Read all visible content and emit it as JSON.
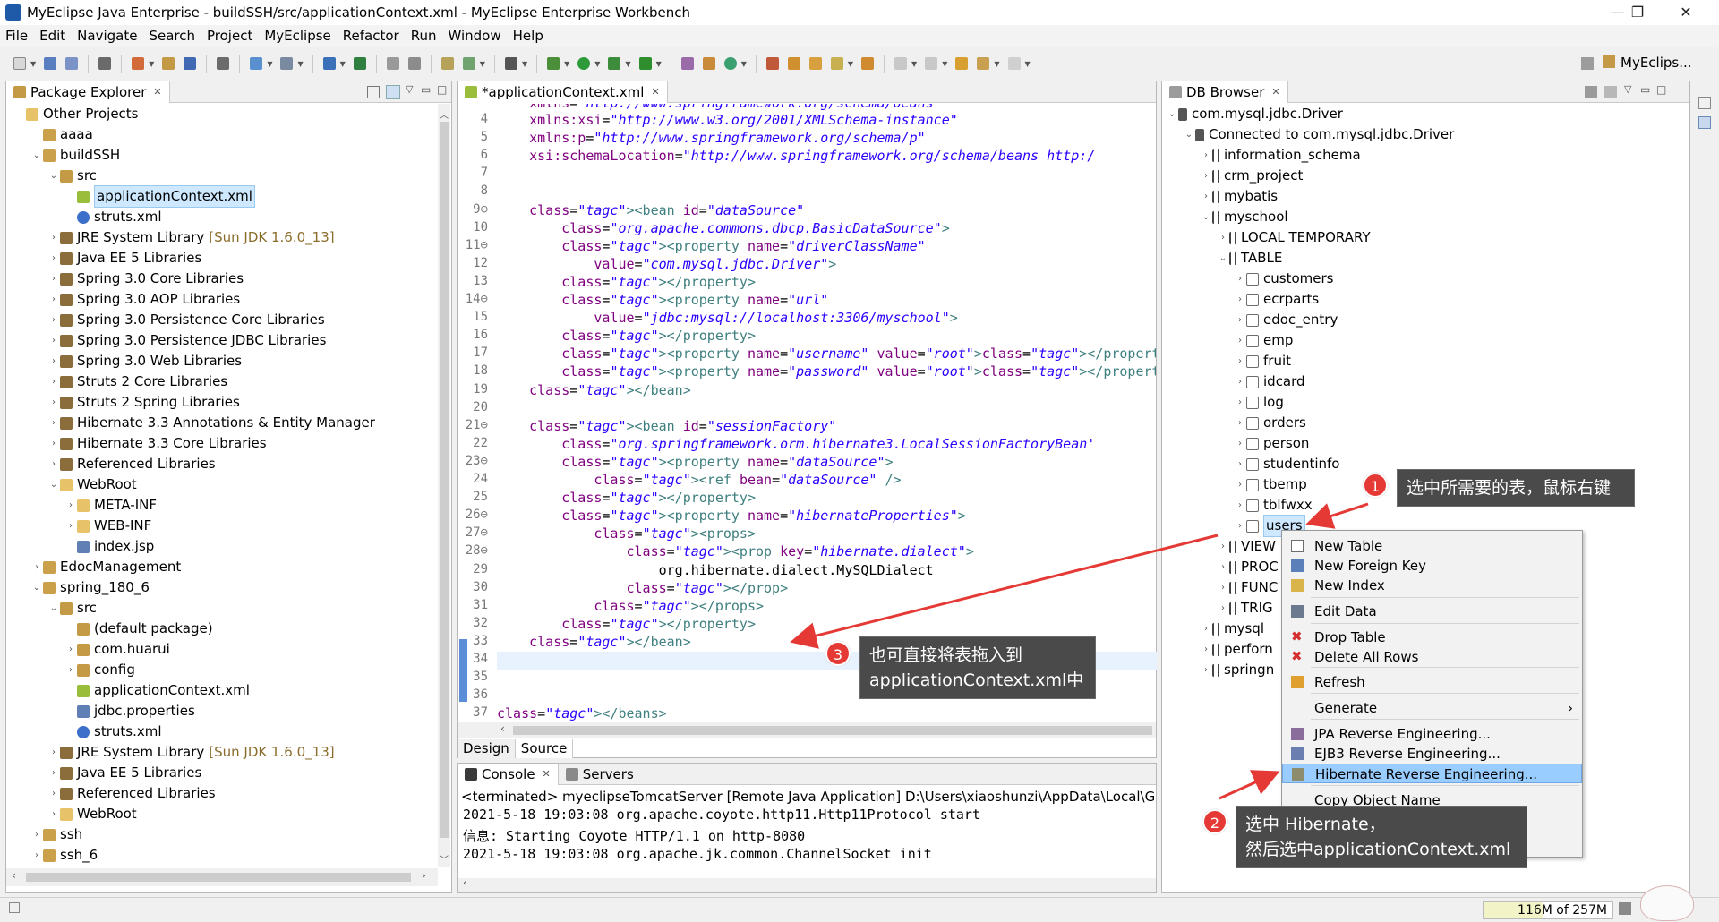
{
  "window": {
    "title": "MyEclipse Java Enterprise - buildSSH/src/applicationContext.xml - MyEclipse Enterprise Workbench",
    "minimize": "—",
    "maximize": "❐",
    "close": "✕"
  },
  "menu": [
    "File",
    "Edit",
    "Navigate",
    "Search",
    "Project",
    "MyEclipse",
    "Refactor",
    "Run",
    "Window",
    "Help"
  ],
  "perspective": "MyEclips...",
  "package_explorer": {
    "title": "Package Explorer",
    "rows": [
      {
        "label": "Other Projects",
        "suffix": ""
      },
      {
        "label": "aaaa",
        "suffix": ""
      },
      {
        "label": "buildSSH",
        "suffix": ""
      },
      {
        "label": "src",
        "suffix": ""
      },
      {
        "label": "applicationContext.xml",
        "suffix": ""
      },
      {
        "label": "struts.xml",
        "suffix": ""
      },
      {
        "label": "JRE System Library",
        "suffix": "[Sun JDK 1.6.0_13]"
      },
      {
        "label": "Java EE 5 Libraries",
        "suffix": ""
      },
      {
        "label": "Spring 3.0 Core Libraries",
        "suffix": ""
      },
      {
        "label": "Spring 3.0 AOP Libraries",
        "suffix": ""
      },
      {
        "label": "Spring 3.0 Persistence Core Libraries",
        "suffix": ""
      },
      {
        "label": "Spring 3.0 Persistence JDBC Libraries",
        "suffix": ""
      },
      {
        "label": "Spring 3.0 Web Libraries",
        "suffix": ""
      },
      {
        "label": "Struts 2 Core Libraries",
        "suffix": ""
      },
      {
        "label": "Struts 2 Spring Libraries",
        "suffix": ""
      },
      {
        "label": "Hibernate 3.3 Annotations & Entity Manager",
        "suffix": ""
      },
      {
        "label": "Hibernate 3.3 Core Libraries",
        "suffix": ""
      },
      {
        "label": "Referenced Libraries",
        "suffix": ""
      },
      {
        "label": "WebRoot",
        "suffix": ""
      },
      {
        "label": "META-INF",
        "suffix": ""
      },
      {
        "label": "WEB-INF",
        "suffix": ""
      },
      {
        "label": "index.jsp",
        "suffix": ""
      },
      {
        "label": "EdocManagement",
        "suffix": ""
      },
      {
        "label": "spring_180_6",
        "suffix": ""
      },
      {
        "label": "src",
        "suffix": ""
      },
      {
        "label": "(default package)",
        "suffix": ""
      },
      {
        "label": "com.huarui",
        "suffix": ""
      },
      {
        "label": "config",
        "suffix": ""
      },
      {
        "label": "applicationContext.xml",
        "suffix": ""
      },
      {
        "label": "jdbc.properties",
        "suffix": ""
      },
      {
        "label": "struts.xml",
        "suffix": ""
      },
      {
        "label": "JRE System Library",
        "suffix": "[Sun JDK 1.6.0_13]"
      },
      {
        "label": "Java EE 5 Libraries",
        "suffix": ""
      },
      {
        "label": "Referenced Libraries",
        "suffix": ""
      },
      {
        "label": "WebRoot",
        "suffix": ""
      },
      {
        "label": "ssh",
        "suffix": ""
      },
      {
        "label": "ssh_6",
        "suffix": ""
      }
    ]
  },
  "editor": {
    "tab": "*applicationContext.xml",
    "bottom_tabs": [
      "Design",
      "Source"
    ],
    "lines": [
      {
        "n": "4",
        "text": "    xmlns:xsi=\"http://www.w3.org/2001/XMLSchema-instance\""
      },
      {
        "n": "5",
        "text": "    xmlns:p=\"http://www.springframework.org/schema/p\""
      },
      {
        "n": "6",
        "text": "    xsi:schemaLocation=\"http://www.springframework.org/schema/beans http:/"
      },
      {
        "n": "7",
        "text": ""
      },
      {
        "n": "8",
        "text": ""
      },
      {
        "n": "9⊖",
        "text": "    <bean id=\"dataSource\""
      },
      {
        "n": "10",
        "text": "        class=\"org.apache.commons.dbcp.BasicDataSource\">"
      },
      {
        "n": "11⊖",
        "text": "        <property name=\"driverClassName\""
      },
      {
        "n": "12",
        "text": "            value=\"com.mysql.jdbc.Driver\">"
      },
      {
        "n": "13",
        "text": "        </property>"
      },
      {
        "n": "14⊖",
        "text": "        <property name=\"url\""
      },
      {
        "n": "15",
        "text": "            value=\"jdbc:mysql://localhost:3306/myschool\">"
      },
      {
        "n": "16",
        "text": "        </property>"
      },
      {
        "n": "17",
        "text": "        <property name=\"username\" value=\"root\"></property>"
      },
      {
        "n": "18",
        "text": "        <property name=\"password\" value=\"root\"></property>"
      },
      {
        "n": "19",
        "text": "    </bean>"
      },
      {
        "n": "20",
        "text": ""
      },
      {
        "n": "21⊖",
        "text": "    <bean id=\"sessionFactory\""
      },
      {
        "n": "22",
        "text": "        class=\"org.springframework.orm.hibernate3.LocalSessionFactoryBean'"
      },
      {
        "n": "23⊖",
        "text": "        <property name=\"dataSource\">"
      },
      {
        "n": "24",
        "text": "            <ref bean=\"dataSource\" />"
      },
      {
        "n": "25",
        "text": "        </property>"
      },
      {
        "n": "26⊖",
        "text": "        <property name=\"hibernateProperties\">"
      },
      {
        "n": "27⊖",
        "text": "            <props>"
      },
      {
        "n": "28⊖",
        "text": "                <prop key=\"hibernate.dialect\">"
      },
      {
        "n": "29",
        "text": "                    org.hibernate.dialect.MySQLDialect"
      },
      {
        "n": "30",
        "text": "                </prop>"
      },
      {
        "n": "31",
        "text": "            </props>"
      },
      {
        "n": "32",
        "text": "        </property>"
      },
      {
        "n": "33",
        "text": "    </bean>"
      },
      {
        "n": "34",
        "text": ""
      },
      {
        "n": "35",
        "text": ""
      },
      {
        "n": "36",
        "text": ""
      },
      {
        "n": "37",
        "text": "</beans>"
      }
    ]
  },
  "console": {
    "tabs": [
      "Console",
      "Servers"
    ],
    "header": "<terminated> myeclipseTomcatServer [Remote Java Application] D:\\Users\\xiaoshunzi\\AppData\\Local\\Genu",
    "lines": [
      "2021-5-18 19:03:08 org.apache.coyote.http11.Http11Protocol start",
      "信息: Starting Coyote HTTP/1.1 on http-8080",
      "2021-5-18 19:03:08 org.apache.jk.common.ChannelSocket init"
    ]
  },
  "db_browser": {
    "title": "DB Browser",
    "rows": [
      {
        "label": "com.mysql.jdbc.Driver"
      },
      {
        "label": "Connected to com.mysql.jdbc.Driver"
      },
      {
        "label": "information_schema"
      },
      {
        "label": "crm_project"
      },
      {
        "label": "mybatis"
      },
      {
        "label": "myschool"
      },
      {
        "label": "LOCAL TEMPORARY"
      },
      {
        "label": "TABLE"
      },
      {
        "label": "customers"
      },
      {
        "label": "ecrparts"
      },
      {
        "label": "edoc_entry"
      },
      {
        "label": "emp"
      },
      {
        "label": "fruit"
      },
      {
        "label": "idcard"
      },
      {
        "label": "log"
      },
      {
        "label": "orders"
      },
      {
        "label": "person"
      },
      {
        "label": "studentinfo"
      },
      {
        "label": "tbemp"
      },
      {
        "label": "tblfwxx"
      },
      {
        "label": "users"
      },
      {
        "label": "VIEW"
      },
      {
        "label": "PROC"
      },
      {
        "label": "FUNC"
      },
      {
        "label": "TRIG"
      },
      {
        "label": "mysql"
      },
      {
        "label": "perforn"
      },
      {
        "label": "springn"
      }
    ]
  },
  "context_menu": {
    "items": [
      {
        "label": "New Table",
        "icon": "table-icon"
      },
      {
        "label": "New Foreign Key",
        "icon": "key-icon"
      },
      {
        "label": "New Index",
        "icon": "index-icon"
      },
      {
        "label": "Edit Data",
        "icon": "edit-icon"
      },
      {
        "label": "Drop Table",
        "icon": "delete-icon"
      },
      {
        "label": "Delete All Rows",
        "icon": "delete-icon"
      },
      {
        "label": "Refresh",
        "icon": "refresh-icon"
      },
      {
        "label": "Generate",
        "icon": "",
        "submenu": "›"
      },
      {
        "label": "JPA Reverse Engineering...",
        "icon": "jpa-icon"
      },
      {
        "label": "EJB3 Reverse Engineering...",
        "icon": "ejb-icon"
      },
      {
        "label": "Hibernate Reverse Engineering...",
        "icon": "hibernate-icon"
      },
      {
        "label": "Copy Object Name",
        "icon": ""
      }
    ],
    "highlighted": "Hibernate Reverse Engineering..."
  },
  "annotations": {
    "step1": {
      "badge": "1",
      "text": "选中所需要的表，鼠标右键"
    },
    "step2": {
      "badge": "2",
      "line1": "选中 Hibernate，",
      "line2": "然后选中applicationContext.xml"
    },
    "step3": {
      "badge": "3",
      "line1": "也可直接将表拖入到",
      "line2": "applicationContext.xml中"
    }
  },
  "status": {
    "memory": "116M of 257M"
  },
  "colors": {
    "selection": "#99ccff",
    "callout": "#4a4a4a",
    "arrow": "#e53935",
    "badge": "#e53935"
  }
}
